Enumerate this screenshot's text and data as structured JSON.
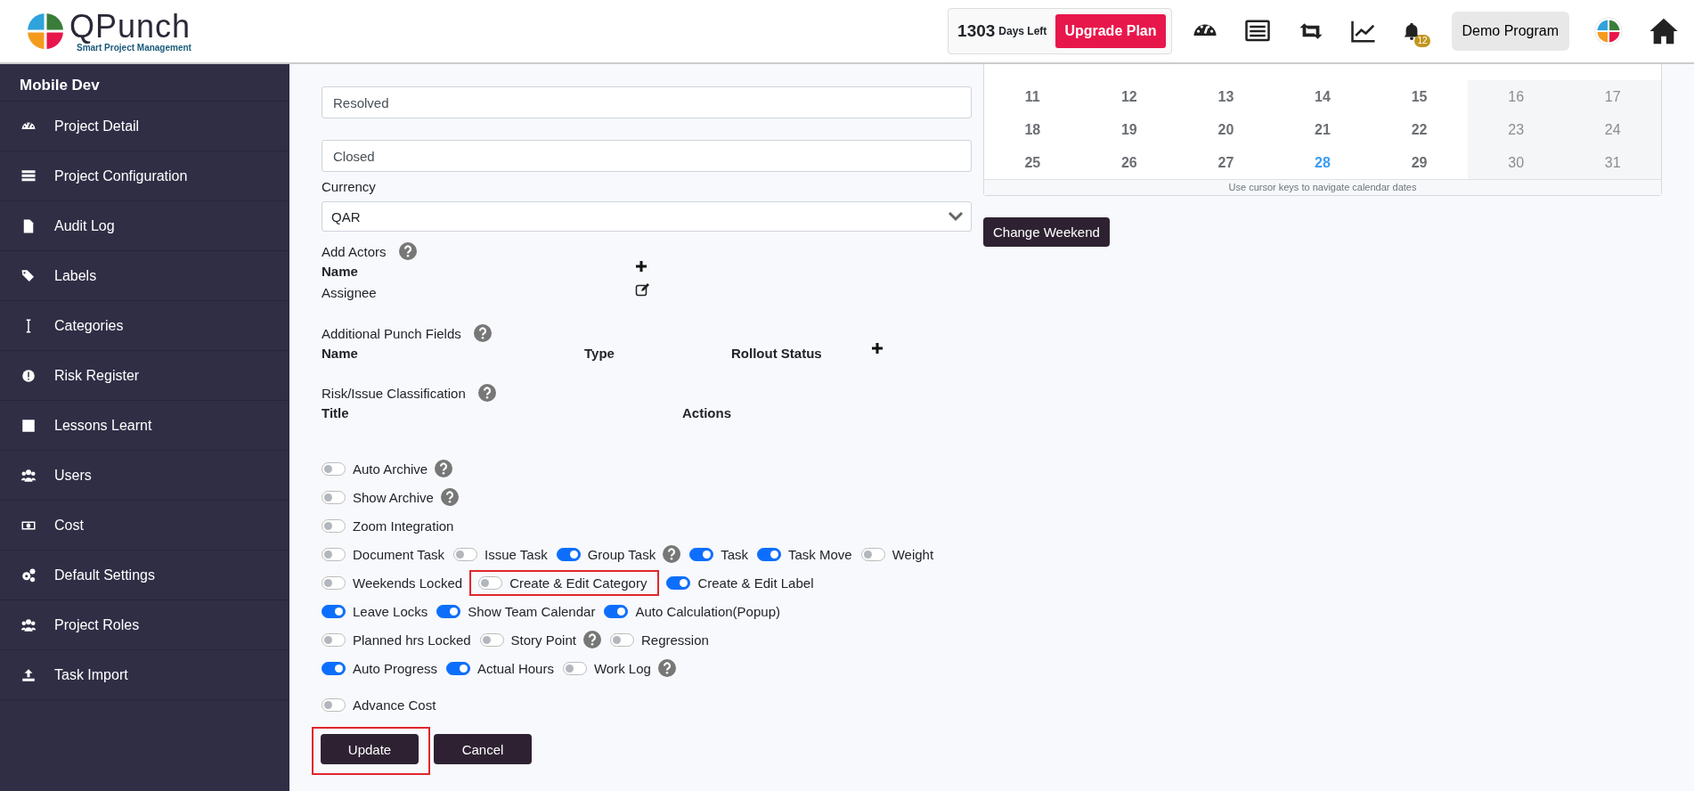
{
  "header": {
    "brand": "QPunch",
    "tagline": "Smart Project Management",
    "days_count": "1303",
    "days_label": "Days Left",
    "upgrade": "Upgrade Plan",
    "notification_count": "12",
    "program": "Demo Program"
  },
  "sidebar": {
    "title": "Mobile Dev",
    "items": [
      {
        "label": "Project Detail"
      },
      {
        "label": "Project Configuration"
      },
      {
        "label": "Audit Log"
      },
      {
        "label": "Labels"
      },
      {
        "label": "Categories"
      },
      {
        "label": "Risk Register"
      },
      {
        "label": "Lessons Learnt"
      },
      {
        "label": "Users"
      },
      {
        "label": "Cost"
      },
      {
        "label": "Default Settings"
      },
      {
        "label": "Project Roles"
      },
      {
        "label": "Task Import"
      }
    ]
  },
  "form": {
    "status_fields": [
      {
        "value": "Resolved"
      },
      {
        "value": "Closed"
      }
    ],
    "currency_label": "Currency",
    "currency_value": "QAR",
    "actors": {
      "title": "Add Actors",
      "columns": [
        "Name"
      ],
      "rows": [
        "Assignee"
      ]
    },
    "punch_fields": {
      "title": "Additional Punch Fields",
      "columns": [
        "Name",
        "Type",
        "Rollout Status"
      ]
    },
    "risk": {
      "title": "Risk/Issue Classification",
      "columns": [
        "Title",
        "Actions"
      ]
    },
    "toggle_rows": [
      [
        {
          "label": "Auto Archive",
          "on": false,
          "help": true,
          "highlighted": false
        }
      ],
      [
        {
          "label": "Show Archive",
          "on": false,
          "help": true,
          "highlighted": false
        }
      ],
      [
        {
          "label": "Zoom Integration",
          "on": false,
          "help": false,
          "highlighted": false
        }
      ],
      [
        {
          "label": "Document Task",
          "on": false,
          "help": false,
          "highlighted": false
        },
        {
          "label": "Issue Task",
          "on": false,
          "help": false,
          "highlighted": false
        },
        {
          "label": "Group Task",
          "on": true,
          "help": true,
          "highlighted": false
        },
        {
          "label": "Task",
          "on": true,
          "help": false,
          "highlighted": false
        },
        {
          "label": "Task Move",
          "on": true,
          "help": false,
          "highlighted": false
        },
        {
          "label": "Weight",
          "on": false,
          "help": false,
          "highlighted": false
        }
      ],
      [
        {
          "label": "Weekends Locked",
          "on": false,
          "help": false,
          "highlighted": false
        },
        {
          "label": "Create & Edit Category",
          "on": false,
          "help": false,
          "highlighted": true
        },
        {
          "label": "Create & Edit Label",
          "on": true,
          "help": false,
          "highlighted": false
        }
      ],
      [
        {
          "label": "Leave Locks",
          "on": true,
          "help": false,
          "highlighted": false
        },
        {
          "label": "Show Team Calendar",
          "on": true,
          "help": false,
          "highlighted": false
        },
        {
          "label": "Auto Calculation(Popup)",
          "on": true,
          "help": false,
          "highlighted": false
        }
      ],
      [
        {
          "label": "Planned hrs Locked",
          "on": false,
          "help": false,
          "highlighted": false
        },
        {
          "label": "Story Point",
          "on": false,
          "help": true,
          "highlighted": false
        },
        {
          "label": "Regression",
          "on": false,
          "help": false,
          "highlighted": false
        }
      ],
      [
        {
          "label": "Auto Progress",
          "on": true,
          "help": false,
          "highlighted": false
        },
        {
          "label": "Actual Hours",
          "on": true,
          "help": false,
          "highlighted": false
        },
        {
          "label": "Work Log",
          "on": false,
          "help": true,
          "highlighted": false
        }
      ],
      [
        {
          "label": "Advance Cost",
          "on": false,
          "help": false,
          "highlighted": false
        }
      ]
    ],
    "buttons": [
      {
        "label": "Update",
        "highlighted": true
      },
      {
        "label": "Cancel",
        "highlighted": false
      }
    ]
  },
  "calendar": {
    "weeks": [
      [
        {
          "day": "11",
          "weekend": false,
          "today": false
        },
        {
          "day": "12",
          "weekend": false,
          "today": false
        },
        {
          "day": "13",
          "weekend": false,
          "today": false
        },
        {
          "day": "14",
          "weekend": false,
          "today": false
        },
        {
          "day": "15",
          "weekend": false,
          "today": false
        },
        {
          "day": "16",
          "weekend": true,
          "today": false
        },
        {
          "day": "17",
          "weekend": true,
          "today": false
        }
      ],
      [
        {
          "day": "18",
          "weekend": false,
          "today": false
        },
        {
          "day": "19",
          "weekend": false,
          "today": false
        },
        {
          "day": "20",
          "weekend": false,
          "today": false
        },
        {
          "day": "21",
          "weekend": false,
          "today": false
        },
        {
          "day": "22",
          "weekend": false,
          "today": false
        },
        {
          "day": "23",
          "weekend": true,
          "today": false
        },
        {
          "day": "24",
          "weekend": true,
          "today": false
        }
      ],
      [
        {
          "day": "25",
          "weekend": false,
          "today": false
        },
        {
          "day": "26",
          "weekend": false,
          "today": false
        },
        {
          "day": "27",
          "weekend": false,
          "today": false
        },
        {
          "day": "28",
          "weekend": false,
          "today": true
        },
        {
          "day": "29",
          "weekend": false,
          "today": false
        },
        {
          "day": "30",
          "weekend": true,
          "today": false
        },
        {
          "day": "31",
          "weekend": true,
          "today": false
        }
      ]
    ],
    "hint": "Use cursor keys to navigate calendar dates",
    "button": "Change Weekend"
  }
}
